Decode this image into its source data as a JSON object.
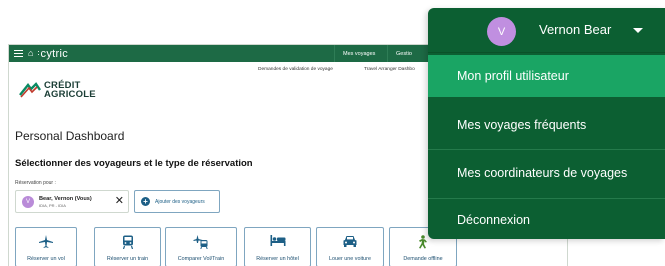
{
  "app": {
    "brand": "cytric",
    "nav": [
      "Mes voyages",
      "Gestio"
    ],
    "subnav": [
      "Demandes de validation de voyage",
      "Travel Arranger Dashbo"
    ],
    "company_logo": [
      "CRÉDIT",
      "AGRICOLE"
    ],
    "dashboard_title": "Personal Dashboard",
    "section_title": "Sélectionner des voyageurs et le type de réservation",
    "reservation_label": "Réservation pour :",
    "traveler": {
      "initial": "V",
      "name": "Bear, Vernon (Vous)",
      "sub": "IDIA, PR - IDIA"
    },
    "add_traveler_label": "Ajouter des voyageurs",
    "actions": [
      {
        "label": "Réserver un vol",
        "icon": "plane-icon"
      },
      {
        "label": "Réserver un train",
        "icon": "train-icon"
      },
      {
        "label": "Comparer Vol/Train",
        "icon": "plane-train-icon"
      },
      {
        "label": "Réserver un hôtel",
        "icon": "bed-icon"
      },
      {
        "label": "Louer une voiture",
        "icon": "car-icon"
      },
      {
        "label": "Demande offline",
        "icon": "person-walking-icon"
      }
    ]
  },
  "user_menu": {
    "initial": "V",
    "user_name": "Vernon Bear",
    "items": [
      {
        "label": "Mon profil utilisateur",
        "active": true
      },
      {
        "label": "Mes voyages fréquents",
        "active": false
      },
      {
        "label": "Mes coordinateurs de voyages",
        "active": false
      },
      {
        "label": "Déconnexion",
        "active": false
      }
    ]
  },
  "colors": {
    "menu_bg": "#0c5f32",
    "menu_active": "#1aa564",
    "topbar": "#1d6a45",
    "avatar": "#c08fe0",
    "action_text": "#1d4f70"
  }
}
